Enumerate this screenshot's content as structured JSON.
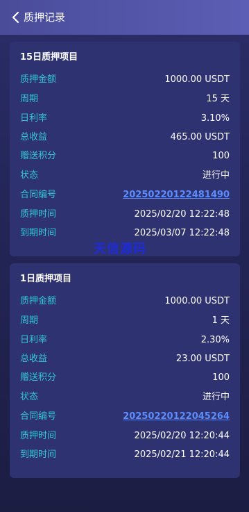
{
  "header": {
    "title": "质押记录"
  },
  "records": [
    {
      "title": "15日质押项目",
      "rows": [
        {
          "label": "质押金额",
          "value": "1000.00 USDT"
        },
        {
          "label": "周期",
          "value": "15 天"
        },
        {
          "label": "日利率",
          "value": "3.10%"
        },
        {
          "label": "总收益",
          "value": "465.00 USDT"
        },
        {
          "label": "赠送积分",
          "value": "100"
        },
        {
          "label": "状态",
          "value": "进行中"
        },
        {
          "label": "合同编号",
          "value": "20250220122481490"
        },
        {
          "label": "质押时间",
          "value": "2025/02/20 12:22:48"
        },
        {
          "label": "到期时间",
          "value": "2025/03/07 12:22:48"
        }
      ]
    },
    {
      "title": "1日质押项目",
      "rows": [
        {
          "label": "质押金额",
          "value": "1000.00 USDT"
        },
        {
          "label": "周期",
          "value": "1 天"
        },
        {
          "label": "日利率",
          "value": "2.30%"
        },
        {
          "label": "总收益",
          "value": "23.00 USDT"
        },
        {
          "label": "赠送积分",
          "value": "100"
        },
        {
          "label": "状态",
          "value": "进行中"
        },
        {
          "label": "合同编号",
          "value": "20250220122045264"
        },
        {
          "label": "质押时间",
          "value": "2025/02/20 12:20:44"
        },
        {
          "label": "到期时间",
          "value": "2025/02/21 12:20:44"
        }
      ]
    }
  ],
  "watermark": "天信源码",
  "icons": {
    "back": "chevron-left-icon"
  },
  "colors": {
    "header": "#5558ad",
    "background": "#232556",
    "card": "#2f3270",
    "label": "#33c6d6",
    "link": "#5b8dff",
    "watermark": "#1e2bd6"
  }
}
